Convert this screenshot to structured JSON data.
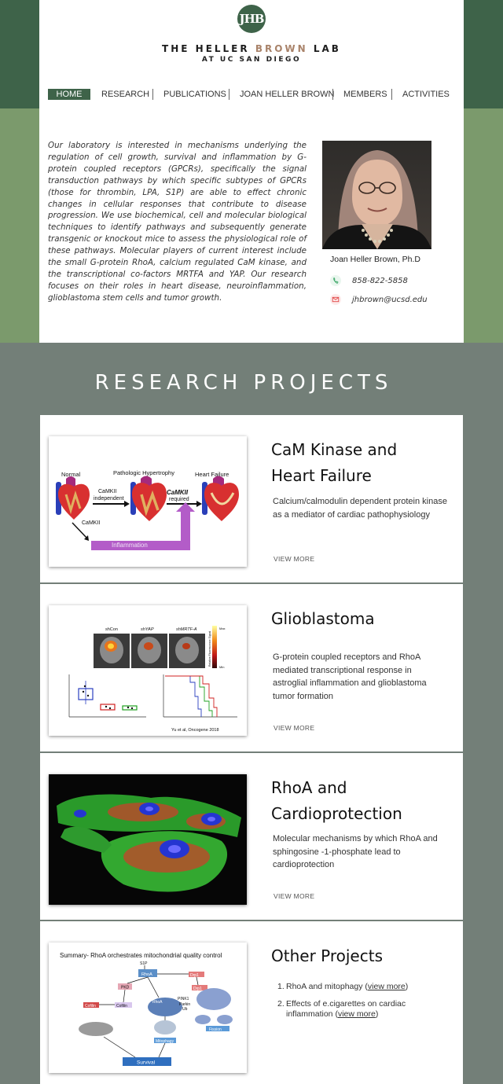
{
  "header": {
    "logo_text": "JHB",
    "title_part1": "THE HELLER ",
    "title_accent": "BROWN",
    "title_part2": " LAB",
    "subtitle": "AT UC SAN DIEGO",
    "brand_color": "#3e6349",
    "accent_color": "#a9836a"
  },
  "nav": {
    "items": [
      "HOME",
      "RESEARCH",
      "PUBLICATIONS",
      "JOAN HELLER BROWN",
      "MEMBERS",
      "ACTIVITIES"
    ],
    "active": "HOME"
  },
  "intro": {
    "text": "Our laboratory is interested in mechanisms underlying the regulation of cell growth, survival and inflammation by G-protein coupled receptors (GPCRs), specifically the signal transduction pathways by which specific subtypes of GPCRs (those for thrombin, LPA, S1P) are able to effect chronic changes in cellular responses that contribute to disease progression. We use biochemical, cell and molecular biological techniques to identify pathways and subsequently generate transgenic or knockout mice to assess the physiological role of these pathways. Molecular players of current interest include the small G-protein RhoA, calcium regulated CaM kinase, and the transcriptional co-factors MRTFA and YAP. Our research focuses on their roles in heart disease, neuroinflammation, glioblastoma stem cells and tumor growth."
  },
  "profile": {
    "name": "Joan Heller Brown, Ph.D",
    "phone": "858-822-5858",
    "email": "jhbrown@ucsd.edu",
    "phone_icon": "phone-icon",
    "email_icon": "envelope-icon"
  },
  "research": {
    "section_title": "RESEARCH PROJECTS",
    "view_more": "VIEW MORE",
    "projects": [
      {
        "title_line1": "CaM Kinase and",
        "title_line2": "Heart Failure",
        "description": "Calcium/calmodulin dependent protein kinase as a mediator of cardiac pathophysiology",
        "figure": {
          "normal": "Normal",
          "hypertrophy": "Pathologic Hypertrophy",
          "failure": "Heart Failure",
          "camkii": "CaMKII",
          "independent": "independent",
          "required": "required",
          "inflammation": "Inflammation"
        }
      },
      {
        "title_line1": "Glioblastoma",
        "title_line2": "",
        "description": "G-protein coupled receptors and RhoA mediated transcriptional response in astroglial inflammation  and glioblastoma tumor formation",
        "figure": {
          "labels": [
            "shCon",
            "shYAP",
            "shMRTF-A"
          ],
          "scale_max": "Max",
          "scale_min": "Min",
          "scale_title": "Relative Fluorescence Signal",
          "citation": "Yu et al, Oncogene 2018"
        }
      },
      {
        "title_line1": "RhoA and",
        "title_line2": "Cardioprotection",
        "description": "Molecular mechanisms by which RhoA and sphingosine -1-phosphate lead to  cardioprotection"
      },
      {
        "title_line1": "Other Projects",
        "title_line2": "",
        "items": [
          {
            "num": "1.",
            "text": "RhoA and mitophagy (",
            "link": "view more",
            "after": ")"
          },
          {
            "num": "2.",
            "text": "Effects of e.cigarettes on cardiac inflammation (",
            "link": "view more",
            "after": ")"
          }
        ],
        "figure": {
          "title": "Summary- RhoA orchestrates  mitochondrial quality control",
          "s1p": "S1P",
          "rhoa": "RhoA",
          "pkd": "PKD",
          "drp1": "Drp1",
          "pink1": "PINK1",
          "parkin": "Parkin",
          "ub": "Ub",
          "cofilin": "Cofilin",
          "mitophagy": "Mitophagy",
          "fission": "Fission",
          "survival": "Survival"
        }
      }
    ]
  }
}
